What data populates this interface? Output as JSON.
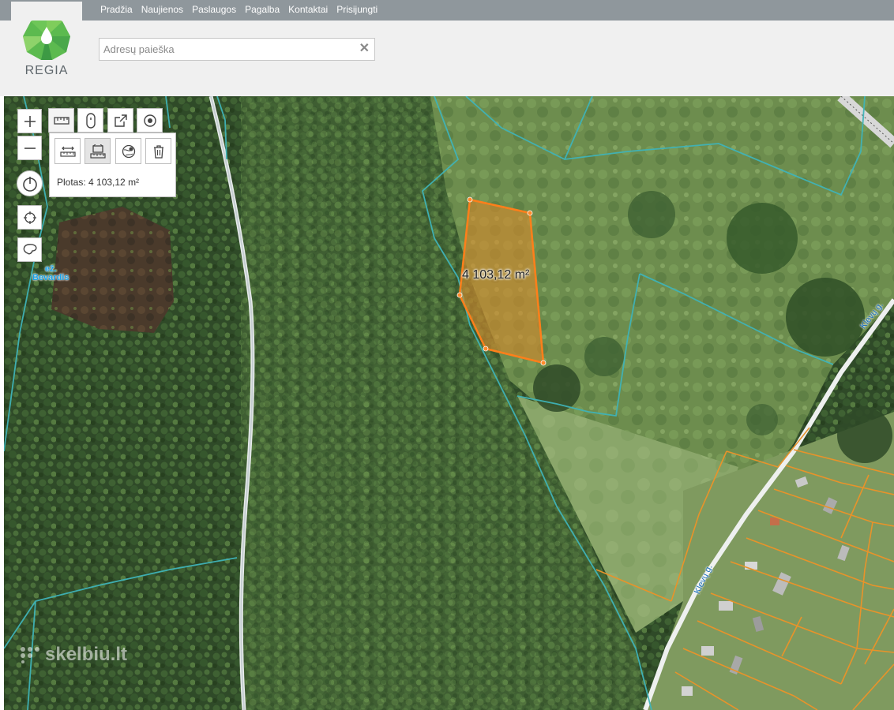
{
  "nav": {
    "links": [
      "Pradžia",
      "Naujienos",
      "Paslaugos",
      "Pagalba",
      "Kontaktai",
      "Prisijungti"
    ]
  },
  "logo": {
    "text": "REGIA"
  },
  "search": {
    "placeholder": "Adresų paieška",
    "clear_label": "✕"
  },
  "measure": {
    "result": "Plotas: 4 103,12 m²",
    "area_label": "4 103,12 m²"
  },
  "map_labels": {
    "lake_line1": "ež.",
    "lake_line2": "Bevardis",
    "street_1": "Klevų g.",
    "street_2": "Klevų g."
  },
  "watermark": {
    "text": "skelbiu.lt"
  },
  "colors": {
    "nav_bg": "#8f979c",
    "header_bg": "#f0f0f0",
    "parcel_fill": "#d98a2b",
    "parcel_stroke": "#ff7f1a",
    "cadastre_teal": "#3fb3b8",
    "cadastre_orange": "#e8932a"
  }
}
